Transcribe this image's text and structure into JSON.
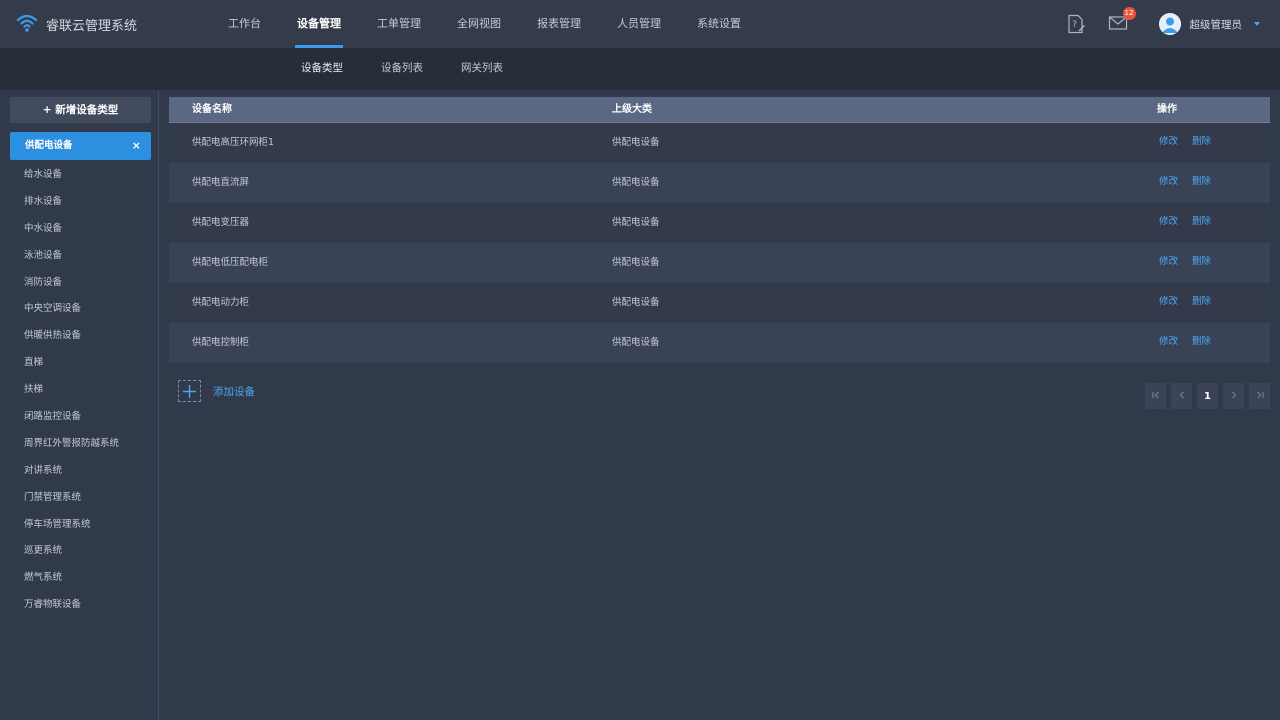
{
  "app": {
    "title": "睿联云管理系统"
  },
  "main_nav": [
    {
      "label": "工作台",
      "active": false
    },
    {
      "label": "设备管理",
      "active": true
    },
    {
      "label": "工单管理",
      "active": false
    },
    {
      "label": "全网视图",
      "active": false
    },
    {
      "label": "报表管理",
      "active": false
    },
    {
      "label": "人员管理",
      "active": false
    },
    {
      "label": "系统设置",
      "active": false
    }
  ],
  "header": {
    "help_icon": "help-document-icon",
    "mail_icon": "mail-icon",
    "mail_badge": "12",
    "user_name": "超级管理员"
  },
  "sub_nav": [
    {
      "label": "设备类型",
      "active": true
    },
    {
      "label": "设备列表",
      "active": false
    },
    {
      "label": "网关列表",
      "active": false
    }
  ],
  "sidebar": {
    "add_button": "+ 新增设备类型",
    "active_item": "供配电设备",
    "close_glyph": "×",
    "items": [
      "给水设备",
      "排水设备",
      "中水设备",
      "泳池设备",
      "消防设备",
      "中央空调设备",
      "供暖供热设备",
      "直梯",
      "扶梯",
      "闭路监控设备",
      "周界红外警报防越系统",
      "对讲系统",
      "门禁管理系统",
      "停车场管理系统",
      "巡更系统",
      "燃气系统",
      "万睿物联设备"
    ]
  },
  "table": {
    "columns": {
      "name": "设备名称",
      "parent": "上级大类",
      "ops": "操作"
    },
    "rows": [
      {
        "name": "供配电高压环网柜1",
        "parent": "供配电设备"
      },
      {
        "name": "供配电直流屏",
        "parent": "供配电设备"
      },
      {
        "name": "供配电变压器",
        "parent": "供配电设备"
      },
      {
        "name": "供配电低压配电柜",
        "parent": "供配电设备"
      },
      {
        "name": "供配电动力柜",
        "parent": "供配电设备"
      },
      {
        "name": "供配电控制柜",
        "parent": "供配电设备"
      }
    ],
    "edit_label": "修改",
    "delete_label": "删除"
  },
  "add_device": {
    "label": "添加设备"
  },
  "pagination": {
    "current": "1"
  },
  "colors": {
    "accent": "#3d9cea",
    "link": "#4aa8f0",
    "badge": "#e8533c",
    "header_row": "#5a6884"
  }
}
